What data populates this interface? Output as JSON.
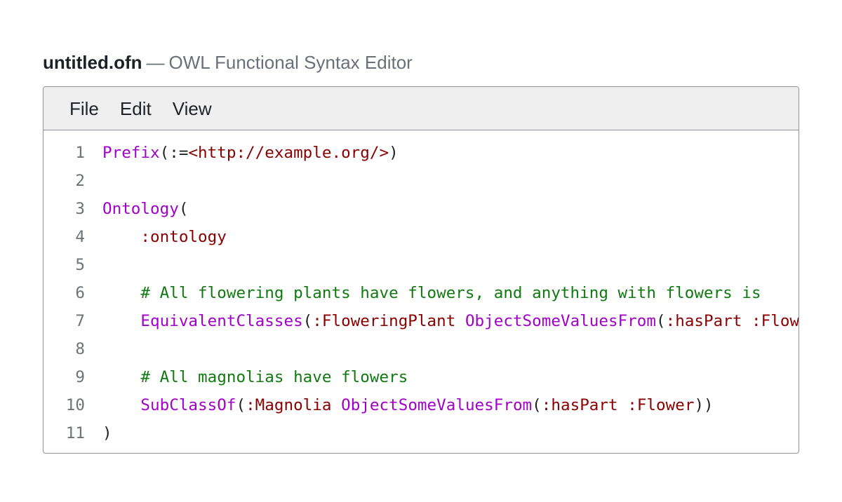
{
  "window": {
    "filename": "untitled.ofn",
    "separator": "—",
    "app_name": "OWL Functional Syntax Editor"
  },
  "menu": {
    "file": "File",
    "edit": "Edit",
    "view": "View"
  },
  "colors": {
    "keyword": "#a100c9",
    "iri": "#8a0000",
    "comment": "#107a10",
    "punctuation": "#1f2328",
    "line_number": "#6e7378"
  },
  "code": {
    "lines": [
      {
        "num": "1",
        "tokens": [
          {
            "t": "Prefix",
            "k": "kw"
          },
          {
            "t": "(:=",
            "k": "pn"
          },
          {
            "t": "<http://example.org/>",
            "k": "iri"
          },
          {
            "t": ")",
            "k": "pn"
          }
        ]
      },
      {
        "num": "2",
        "tokens": []
      },
      {
        "num": "3",
        "tokens": [
          {
            "t": "Ontology",
            "k": "kw"
          },
          {
            "t": "(",
            "k": "pn"
          }
        ]
      },
      {
        "num": "4",
        "tokens": [
          {
            "t": "    ",
            "k": "pn"
          },
          {
            "t": ":ontology",
            "k": "iri"
          }
        ]
      },
      {
        "num": "5",
        "tokens": []
      },
      {
        "num": "6",
        "tokens": [
          {
            "t": "    ",
            "k": "pn"
          },
          {
            "t": "# All flowering plants have flowers, and anything with flowers is",
            "k": "cm"
          }
        ]
      },
      {
        "num": "7",
        "tokens": [
          {
            "t": "    ",
            "k": "pn"
          },
          {
            "t": "EquivalentClasses",
            "k": "kw"
          },
          {
            "t": "(",
            "k": "pn"
          },
          {
            "t": ":FloweringPlant",
            "k": "iri"
          },
          {
            "t": " ",
            "k": "pn"
          },
          {
            "t": "ObjectSomeValuesFrom",
            "k": "kw"
          },
          {
            "t": "(",
            "k": "pn"
          },
          {
            "t": ":hasPart",
            "k": "iri"
          },
          {
            "t": " ",
            "k": "pn"
          },
          {
            "t": ":Flower",
            "k": "iri"
          },
          {
            "t": "))",
            "k": "pn"
          }
        ]
      },
      {
        "num": "8",
        "tokens": []
      },
      {
        "num": "9",
        "tokens": [
          {
            "t": "    ",
            "k": "pn"
          },
          {
            "t": "# All magnolias have flowers",
            "k": "cm"
          }
        ]
      },
      {
        "num": "10",
        "tokens": [
          {
            "t": "    ",
            "k": "pn"
          },
          {
            "t": "SubClassOf",
            "k": "kw"
          },
          {
            "t": "(",
            "k": "pn"
          },
          {
            "t": ":Magnolia",
            "k": "iri"
          },
          {
            "t": " ",
            "k": "pn"
          },
          {
            "t": "ObjectSomeValuesFrom",
            "k": "kw"
          },
          {
            "t": "(",
            "k": "pn"
          },
          {
            "t": ":hasPart",
            "k": "iri"
          },
          {
            "t": " ",
            "k": "pn"
          },
          {
            "t": ":Flower",
            "k": "iri"
          },
          {
            "t": "))",
            "k": "pn"
          }
        ]
      },
      {
        "num": "11",
        "tokens": [
          {
            "t": ")",
            "k": "pn"
          }
        ]
      }
    ]
  }
}
